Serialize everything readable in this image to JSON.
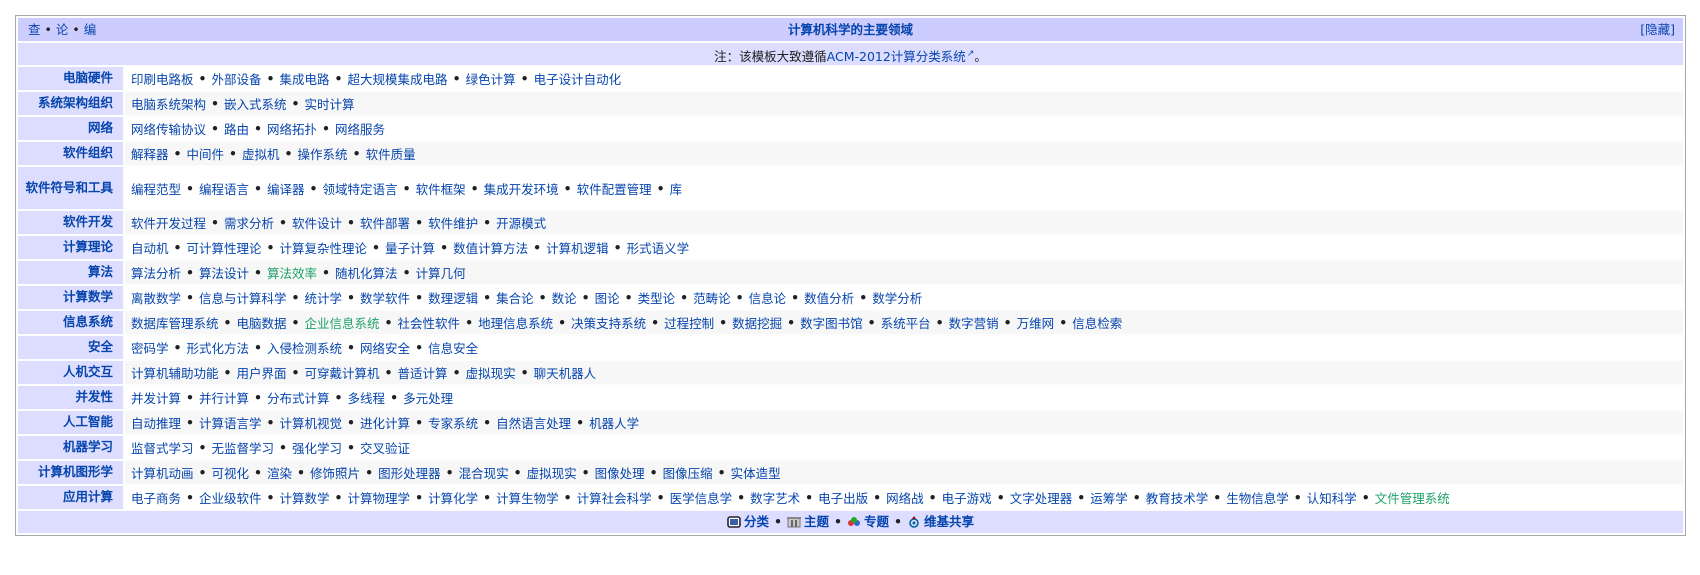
{
  "title": {
    "vde": [
      "查",
      "论",
      "编"
    ],
    "text": "计算机科学的主要领域",
    "hide_label": "[隐藏]"
  },
  "note": {
    "prefix": "注：该模板大致遵循",
    "link": "ACM-2012计算分类系统",
    "suffix": "。"
  },
  "rows": [
    {
      "group": "电脑硬件",
      "items": [
        "印刷电路板",
        "外部设备",
        "集成电路",
        "超大规模集成电路",
        "绿色计算",
        "电子设计自动化"
      ]
    },
    {
      "group": "系统架构组织",
      "items": [
        "电脑系统架构",
        "嵌入式系统",
        "实时计算"
      ]
    },
    {
      "group": "网络",
      "items": [
        "网络传输协议",
        "路由",
        "网络拓扑",
        "网络服务"
      ]
    },
    {
      "group": "软件组织",
      "items": [
        "解释器",
        "中间件",
        "虚拟机",
        "操作系统",
        "软件质量"
      ]
    },
    {
      "group": "软件符号和工具",
      "items": [
        "编程范型",
        "编程语言",
        "编译器",
        "领域特定语言",
        "软件框架",
        "集成开发环境",
        "软件配置管理",
        "库"
      ]
    },
    {
      "group": "软件开发",
      "items": [
        "软件开发过程",
        "需求分析",
        "软件设计",
        "软件部署",
        "软件维护",
        "开源模式"
      ]
    },
    {
      "group": "计算理论",
      "items": [
        "自动机",
        "可计算性理论",
        "计算复杂性理论",
        "量子计算",
        "数值计算方法",
        "计算机逻辑",
        "形式语义学"
      ]
    },
    {
      "group": "算法",
      "items": [
        "算法分析",
        "算法设计",
        "算法效率",
        "随机化算法",
        "计算几何"
      ],
      "green": [
        "算法效率"
      ]
    },
    {
      "group": "计算数学",
      "items": [
        "离散数学",
        "信息与计算科学",
        "统计学",
        "数学软件",
        "数理逻辑",
        "集合论",
        "数论",
        "图论",
        "类型论",
        "范畴论",
        "信息论",
        "数值分析",
        "数学分析"
      ]
    },
    {
      "group": "信息系统",
      "items": [
        "数据库管理系统",
        "电脑数据",
        "企业信息系统",
        "社会性软件",
        "地理信息系统",
        "决策支持系统",
        "过程控制",
        "数据挖掘",
        "数字图书馆",
        "系统平台",
        "数字营销",
        "万维网",
        "信息检索"
      ],
      "green": [
        "企业信息系统"
      ]
    },
    {
      "group": "安全",
      "items": [
        "密码学",
        "形式化方法",
        "入侵检测系统",
        "网络安全",
        "信息安全"
      ]
    },
    {
      "group": "人机交互",
      "items": [
        "计算机辅助功能",
        "用户界面",
        "可穿戴计算机",
        "普适计算",
        "虚拟现实",
        "聊天机器人"
      ]
    },
    {
      "group": "并发性",
      "items": [
        "并发计算",
        "并行计算",
        "分布式计算",
        "多线程",
        "多元处理"
      ]
    },
    {
      "group": "人工智能",
      "items": [
        "自动推理",
        "计算语言学",
        "计算机视觉",
        "进化计算",
        "专家系统",
        "自然语言处理",
        "机器人学"
      ]
    },
    {
      "group": "机器学习",
      "items": [
        "监督式学习",
        "无监督学习",
        "强化学习",
        "交叉验证"
      ]
    },
    {
      "group": "计算机图形学",
      "items": [
        "计算机动画",
        "可视化",
        "渲染",
        "修饰照片",
        "图形处理器",
        "混合现实",
        "虚拟现实",
        "图像处理",
        "图像压缩",
        "实体造型"
      ]
    },
    {
      "group": "应用计算",
      "items": [
        "电子商务",
        "企业级软件",
        "计算数学",
        "计算物理学",
        "计算化学",
        "计算生物学",
        "计算社会科学",
        "医学信息学",
        "数字艺术",
        "电子出版",
        "网络战",
        "电子游戏",
        "文字处理器",
        "运筹学",
        "教育技术学",
        "生物信息学",
        "认知科学",
        "文件管理系统"
      ],
      "green": [
        "文件管理系统"
      ]
    }
  ],
  "footer": {
    "items": [
      {
        "label": "分类",
        "icon": "category-icon"
      },
      {
        "label": "主题",
        "icon": "portal-icon"
      },
      {
        "label": "专题",
        "icon": "wikiproject-icon"
      },
      {
        "label": "维基共享",
        "icon": "commons-icon"
      }
    ]
  },
  "colors": {
    "title_bg": "#ccccff",
    "group_bg": "#ddddff",
    "link": "#0645ad",
    "green_link": "#20a16b"
  }
}
